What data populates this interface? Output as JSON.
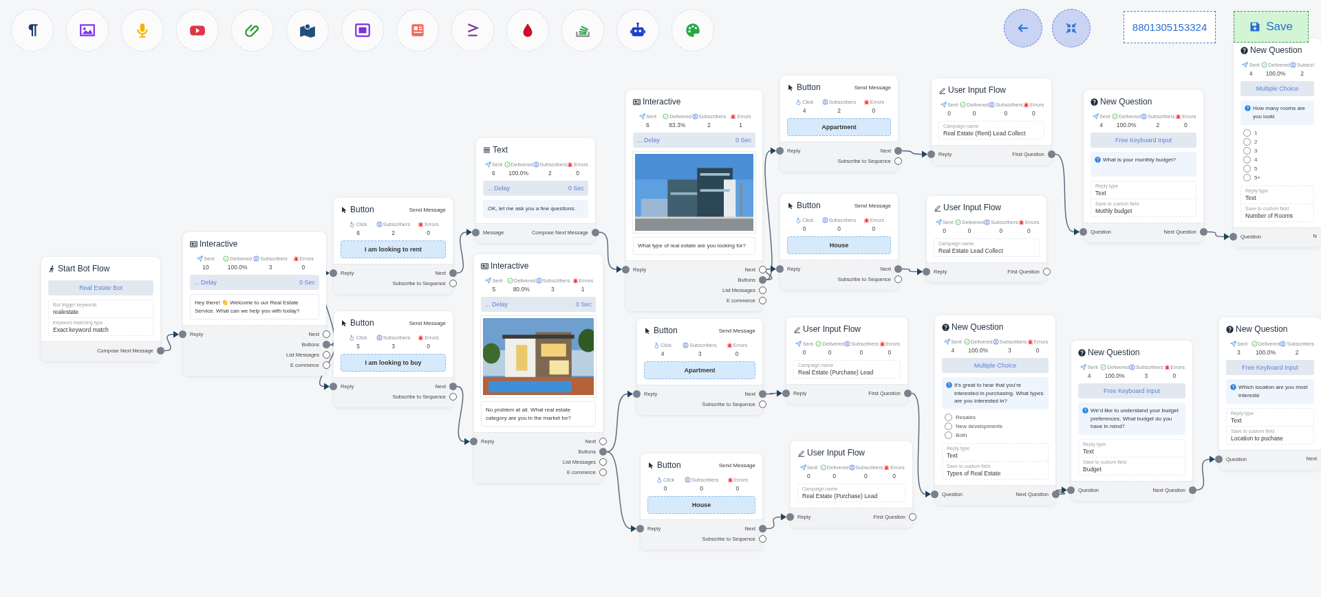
{
  "toolbar": {
    "phone": "8801305153324",
    "save": "Save"
  },
  "nodes": [
    {
      "kind": "start",
      "title": "Start Bot Flow",
      "band": "Real Estate Bot",
      "fields": [
        {
          "label": "Bot trigger keywords",
          "value": "realestate"
        },
        {
          "label": "Keyword matching type",
          "value": "Exact keyword match"
        }
      ],
      "outputs": [
        {
          "label": "Compose Next Message",
          "connected": true
        }
      ]
    },
    {
      "kind": "interactive",
      "title": "Interactive",
      "stats": [
        {
          "kind": "sent",
          "label": "Sent",
          "value": "10"
        },
        {
          "kind": "delivered",
          "label": "Delivered",
          "value": "100.0%"
        },
        {
          "kind": "subscribers",
          "label": "Subscribers",
          "value": "3"
        },
        {
          "kind": "errors",
          "label": "Errors",
          "value": "0"
        }
      ],
      "delay": {
        "label": "... Delay",
        "value": "0 Sec"
      },
      "message": "Hey there! 👋 Welcome to our Real Estate Service. What can we help you with today?",
      "input": "Reply",
      "outputs": [
        {
          "label": "Next",
          "connected": false
        },
        {
          "label": "Buttons",
          "connected": true
        },
        {
          "label": "List Messages",
          "connected": false
        },
        {
          "label": "E commerce",
          "connected": false
        }
      ]
    },
    {
      "kind": "button",
      "title": "Button",
      "action": "Send Message",
      "stats": [
        {
          "kind": "click",
          "label": "Click",
          "value": "6"
        },
        {
          "kind": "subscribers",
          "label": "Subscribers",
          "value": "2"
        },
        {
          "kind": "errors",
          "label": "Errors",
          "value": "0"
        }
      ],
      "button": "I am looking to rent",
      "input": "Reply",
      "outputs": [
        {
          "label": "Next",
          "connected": true
        },
        {
          "label": "Subscribe to Sequence",
          "connected": false
        }
      ]
    },
    {
      "kind": "button",
      "title": "Button",
      "action": "Send Message",
      "stats": [
        {
          "kind": "click",
          "label": "Click",
          "value": "5"
        },
        {
          "kind": "subscribers",
          "label": "Subscribers",
          "value": "3"
        },
        {
          "kind": "errors",
          "label": "Errors",
          "value": "0"
        }
      ],
      "button": "I am looking to buy",
      "input": "Reply",
      "outputs": [
        {
          "label": "Next",
          "connected": true
        },
        {
          "label": "Subscribe to Sequence",
          "connected": false
        }
      ]
    },
    {
      "kind": "text",
      "title": "Text",
      "stats": [
        {
          "kind": "sent",
          "label": "Sent",
          "value": "6"
        },
        {
          "kind": "delivered",
          "label": "Delivered",
          "value": "100.0%"
        },
        {
          "kind": "subscribers",
          "label": "Subscribers",
          "value": "2"
        },
        {
          "kind": "errors",
          "label": "Errors",
          "value": "0"
        }
      ],
      "delay": {
        "label": "... Delay",
        "value": "0 Sec"
      },
      "message": "OK, let me ask you a few questions.",
      "input": "Message",
      "outputs": [
        {
          "label": "Compose Next Message",
          "connected": true
        }
      ]
    },
    {
      "kind": "interactive",
      "title": "Interactive",
      "stats": [
        {
          "kind": "sent",
          "label": "Sent",
          "value": "5"
        },
        {
          "kind": "delivered",
          "label": "Delivered",
          "value": "80.0%"
        },
        {
          "kind": "subscribers",
          "label": "Subscribers",
          "value": "3"
        },
        {
          "kind": "errors",
          "label": "Errors",
          "value": "1"
        }
      ],
      "delay": {
        "label": "... Delay",
        "value": "0 Sec"
      },
      "message": "No problem at all. What real estate category are you in the market for?",
      "input": "Reply",
      "outputs": [
        {
          "label": "Next",
          "connected": false
        },
        {
          "label": "Buttons",
          "connected": true
        },
        {
          "label": "List Messages",
          "connected": false
        },
        {
          "label": "E commerce",
          "connected": false
        }
      ]
    },
    {
      "kind": "interactive",
      "title": "Interactive",
      "stats": [
        {
          "kind": "sent",
          "label": "Sent",
          "value": "6"
        },
        {
          "kind": "delivered",
          "label": "Delivered",
          "value": "83.3%"
        },
        {
          "kind": "subscribers",
          "label": "Subscribers",
          "value": "2"
        },
        {
          "kind": "errors",
          "label": "Errors",
          "value": "1"
        }
      ],
      "delay": {
        "label": "... Delay",
        "value": "0 Sec"
      },
      "message": "What type of real estate are you looking for?",
      "input": "Reply",
      "outputs": [
        {
          "label": "Next",
          "connected": false
        },
        {
          "label": "Buttons",
          "connected": true
        },
        {
          "label": "List Messages",
          "connected": false
        },
        {
          "label": "E commerce",
          "connected": false
        }
      ]
    },
    {
      "kind": "button",
      "title": "Button",
      "action": "Send Message",
      "stats": [
        {
          "kind": "click",
          "label": "Click",
          "value": "4"
        },
        {
          "kind": "subscribers",
          "label": "Subscribers",
          "value": "2"
        },
        {
          "kind": "errors",
          "label": "Errors",
          "value": "0"
        }
      ],
      "button": "Appartment",
      "input": "Reply",
      "outputs": [
        {
          "label": "Next",
          "connected": true
        },
        {
          "label": "Subscribe to Sequence",
          "connected": false
        }
      ]
    },
    {
      "kind": "button",
      "title": "Button",
      "action": "Send Message",
      "stats": [
        {
          "kind": "click",
          "label": "Click",
          "value": "0"
        },
        {
          "kind": "subscribers",
          "label": "Subscribers",
          "value": "0"
        },
        {
          "kind": "errors",
          "label": "Errors",
          "value": "0"
        }
      ],
      "button": "House",
      "input": "Reply",
      "outputs": [
        {
          "label": "Next",
          "connected": true
        },
        {
          "label": "Subscribe to Sequence",
          "connected": false
        }
      ]
    },
    {
      "kind": "user_input",
      "title": "User Input Flow",
      "stats": [
        {
          "kind": "sent",
          "label": "Sent",
          "value": "0"
        },
        {
          "kind": "delivered",
          "label": "Delivered",
          "value": "0"
        },
        {
          "kind": "subscribers",
          "label": "Subscribers",
          "value": "0"
        },
        {
          "kind": "errors",
          "label": "Errors",
          "value": "0"
        }
      ],
      "fields": [
        {
          "label": "Campaign name",
          "value": "Real Estate (Rent) Lead Collect"
        }
      ],
      "input": "Reply",
      "outputs": [
        {
          "label": "First Question",
          "connected": true
        }
      ]
    },
    {
      "kind": "user_input",
      "title": "User Input Flow",
      "stats": [
        {
          "kind": "sent",
          "label": "Sent",
          "value": "0"
        },
        {
          "kind": "delivered",
          "label": "Delivered",
          "value": "0"
        },
        {
          "kind": "subscribers",
          "label": "Subscribers",
          "value": "0"
        },
        {
          "kind": "errors",
          "label": "Errors",
          "value": "0"
        }
      ],
      "fields": [
        {
          "label": "Campaign name",
          "value": "Real Estate Lead Collect"
        }
      ],
      "input": "Reply",
      "outputs": [
        {
          "label": "First Question",
          "connected": false
        }
      ]
    },
    {
      "kind": "question",
      "title": "New Question",
      "stats": [
        {
          "kind": "sent",
          "label": "Sent",
          "value": "4"
        },
        {
          "kind": "delivered",
          "label": "Delivered",
          "value": "100.0%"
        },
        {
          "kind": "subscribers",
          "label": "Subscribers",
          "value": "2"
        },
        {
          "kind": "errors",
          "label": "Errors",
          "value": "0"
        }
      ],
      "band": "Free Keyboard Input",
      "question": "What is your monthly budget?",
      "fields": [
        {
          "label": "Reply type",
          "value": "Text"
        },
        {
          "label": "Save to custom field",
          "value": "Mothly budget"
        }
      ],
      "input": "Question",
      "outputs": [
        {
          "label": "Next Question",
          "connected": true
        }
      ]
    },
    {
      "kind": "question",
      "title": "New Question",
      "stats": [
        {
          "kind": "sent",
          "label": "Sent",
          "value": "4"
        },
        {
          "kind": "delivered",
          "label": "Delivered",
          "value": "100.0%"
        },
        {
          "kind": "subscribers",
          "label": "Subscri",
          "value": "2"
        }
      ],
      "band": "Multiple Choice",
      "question": "How many rooms are you looki",
      "options": [
        {
          "label": "1",
          "selected": false
        },
        {
          "label": "2",
          "selected": false
        },
        {
          "label": "3",
          "selected": false
        },
        {
          "label": "4",
          "selected": false
        },
        {
          "label": "5",
          "selected": false
        },
        {
          "label": "5+",
          "selected": false
        }
      ],
      "fields": [
        {
          "label": "Reply type",
          "value": "Text"
        },
        {
          "label": "Save to custom field",
          "value": "Number of Rooms"
        }
      ],
      "input": "Question",
      "outputs": [
        {
          "label": "N"
        }
      ]
    },
    {
      "kind": "button",
      "title": "Button",
      "action": "Send Message",
      "stats": [
        {
          "kind": "click",
          "label": "Click",
          "value": "4"
        },
        {
          "kind": "subscribers",
          "label": "Subscribers",
          "value": "3"
        },
        {
          "kind": "errors",
          "label": "Errors",
          "value": "0"
        }
      ],
      "button": "Apartment",
      "input": "Reply",
      "outputs": [
        {
          "label": "Next",
          "connected": true
        },
        {
          "label": "Subscribe to Sequence",
          "connected": false
        }
      ]
    },
    {
      "kind": "user_input",
      "title": "User Input Flow",
      "stats": [
        {
          "kind": "sent",
          "label": "Sent",
          "value": "0"
        },
        {
          "kind": "delivered",
          "label": "Delivered",
          "value": "0"
        },
        {
          "kind": "subscribers",
          "label": "Subscribers",
          "value": "0"
        },
        {
          "kind": "errors",
          "label": "Errors",
          "value": "0"
        }
      ],
      "fields": [
        {
          "label": "Campaign name",
          "value": "Real Estate (Purchase) Lead"
        }
      ],
      "input": "Reply",
      "outputs": [
        {
          "label": "First Question",
          "connected": true
        }
      ]
    },
    {
      "kind": "button",
      "title": "Button",
      "action": "Send Message",
      "stats": [
        {
          "kind": "click",
          "label": "Click",
          "value": "0"
        },
        {
          "kind": "subscribers",
          "label": "Subscribers",
          "value": "0"
        },
        {
          "kind": "errors",
          "label": "Errors",
          "value": "0"
        }
      ],
      "button": "House",
      "input": "Reply",
      "outputs": [
        {
          "label": "Next",
          "connected": true
        },
        {
          "label": "Subscribe to Sequence",
          "connected": false
        }
      ]
    },
    {
      "kind": "user_input",
      "title": "User Input Flow",
      "stats": [
        {
          "kind": "sent",
          "label": "Sent",
          "value": "0"
        },
        {
          "kind": "delivered",
          "label": "Delivered",
          "value": "0"
        },
        {
          "kind": "subscribers",
          "label": "Subscribers",
          "value": "0"
        },
        {
          "kind": "errors",
          "label": "Errors",
          "value": "0"
        }
      ],
      "fields": [
        {
          "label": "Campaign name",
          "value": "Real Estate (Purchase) Lead"
        }
      ],
      "input": "Reply",
      "outputs": [
        {
          "label": "First Question",
          "connected": false
        }
      ]
    },
    {
      "kind": "question",
      "title": "New Question",
      "stats": [
        {
          "kind": "sent",
          "label": "Sent",
          "value": "4"
        },
        {
          "kind": "delivered",
          "label": "Delivered",
          "value": "100.0%"
        },
        {
          "kind": "subscribers",
          "label": "Subscribers",
          "value": "3"
        },
        {
          "kind": "errors",
          "label": "Errors",
          "value": "0"
        }
      ],
      "band": "Multiple Choice",
      "question": "It’s great to hear that you’re interested in purchasing. What types are you interested in?",
      "options": [
        {
          "label": "Resales",
          "selected": false
        },
        {
          "label": "New developments",
          "selected": false
        },
        {
          "label": "Both",
          "selected": false
        }
      ],
      "fields": [
        {
          "label": "Reply type",
          "value": "Text"
        },
        {
          "label": "Save to custom field",
          "value": "Types of Real Estate"
        }
      ],
      "input": "Question",
      "outputs": [
        {
          "label": "Next Question",
          "connected": true
        }
      ]
    },
    {
      "kind": "question",
      "title": "New Question",
      "stats": [
        {
          "kind": "sent",
          "label": "Sent",
          "value": "4"
        },
        {
          "kind": "delivered",
          "label": "Delivered",
          "value": "100.0%"
        },
        {
          "kind": "subscribers",
          "label": "Subscribers",
          "value": "3"
        },
        {
          "kind": "errors",
          "label": "Errors",
          "value": "0"
        }
      ],
      "band": "Free Keyboard Input",
      "question": "We’d like to understand your budget preferences. What budget do you have in mind?",
      "fields": [
        {
          "label": "Reply type",
          "value": "Text"
        },
        {
          "label": "Save to custom field",
          "value": "Budget"
        }
      ],
      "input": "Question",
      "outputs": [
        {
          "label": "Next Question",
          "connected": true
        }
      ]
    },
    {
      "kind": "question",
      "title": "New Question",
      "stats": [
        {
          "kind": "sent",
          "label": "Sent",
          "value": "3"
        },
        {
          "kind": "delivered",
          "label": "Delivered",
          "value": "100.0%"
        },
        {
          "kind": "subscribers",
          "label": "Subscribers",
          "value": "2"
        }
      ],
      "band": "Free Keyboard Input",
      "question": "Which location are you most intereste",
      "fields": [
        {
          "label": "Reply type",
          "value": "Text"
        },
        {
          "label": "Save to custom field",
          "value": "Location to puchase"
        }
      ],
      "input": "Question",
      "outputs": [
        {
          "label": "Next"
        }
      ]
    }
  ]
}
